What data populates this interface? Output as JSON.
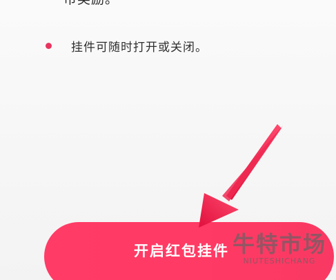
{
  "content": {
    "partial_line": "币奖励。",
    "bullets": [
      {
        "text": "挂件可随时打开或关闭。"
      }
    ]
  },
  "cta": {
    "label": "开启红包挂件"
  },
  "overlay": {
    "arrow_icon": "pointer-arrow-icon",
    "watermark_main": "牛特市场",
    "watermark_sub": "NIUTESHICHANG"
  },
  "colors": {
    "accent": "#ff3b66",
    "bullet": "#e8355f",
    "background": "#f7f6f6"
  }
}
